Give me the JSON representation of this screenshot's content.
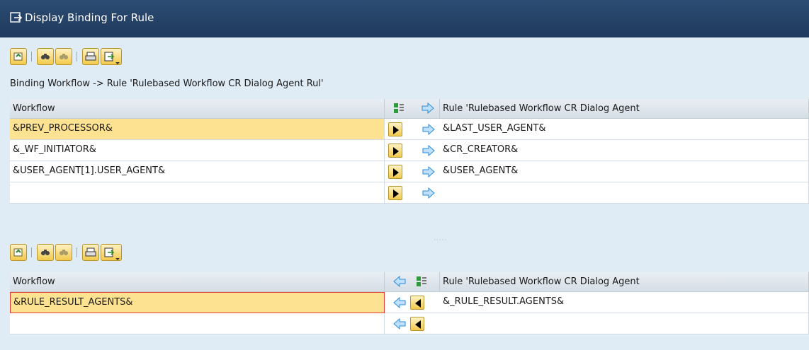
{
  "window": {
    "title": "Display Binding For Rule",
    "title_icon": "display-binding-icon"
  },
  "toolbar_icons": [
    "refresh-icon",
    "find-icon",
    "find-next-icon",
    "print-icon",
    "export-icon",
    "dropdown-icon"
  ],
  "description": "Binding Workflow  -> Rule 'Rulebased Workflow CR Dialog Agent Rul'",
  "top_table": {
    "col_left": "Workflow",
    "col_right": "Rule 'Rulebased Workflow CR Dialog Agent",
    "rows": [
      {
        "left": "&PREV_PROCESSOR&",
        "right": "&LAST_USER_AGENT&",
        "selected": true
      },
      {
        "left": "&_WF_INITIATOR&",
        "right": "&CR_CREATOR&",
        "selected": false
      },
      {
        "left": "&USER_AGENT[1].USER_AGENT&",
        "right": "&USER_AGENT&",
        "selected": false
      },
      {
        "left": "",
        "right": "",
        "selected": false
      }
    ]
  },
  "bottom_table": {
    "col_left": "Workflow",
    "col_right": "Rule 'Rulebased Workflow CR Dialog Agent",
    "rows": [
      {
        "left": "&RULE_RESULT_AGENTS&",
        "right": "&_RULE_RESULT.AGENTS&",
        "selected": true
      },
      {
        "left": "",
        "right": "",
        "selected": false
      }
    ]
  },
  "splitter_label": "·····",
  "colors": {
    "title_bg": "#1f3a5d",
    "selected_row": "#fde391",
    "button_yellow": "#f2c94c",
    "arrow_blue": "#2a8cd8"
  }
}
